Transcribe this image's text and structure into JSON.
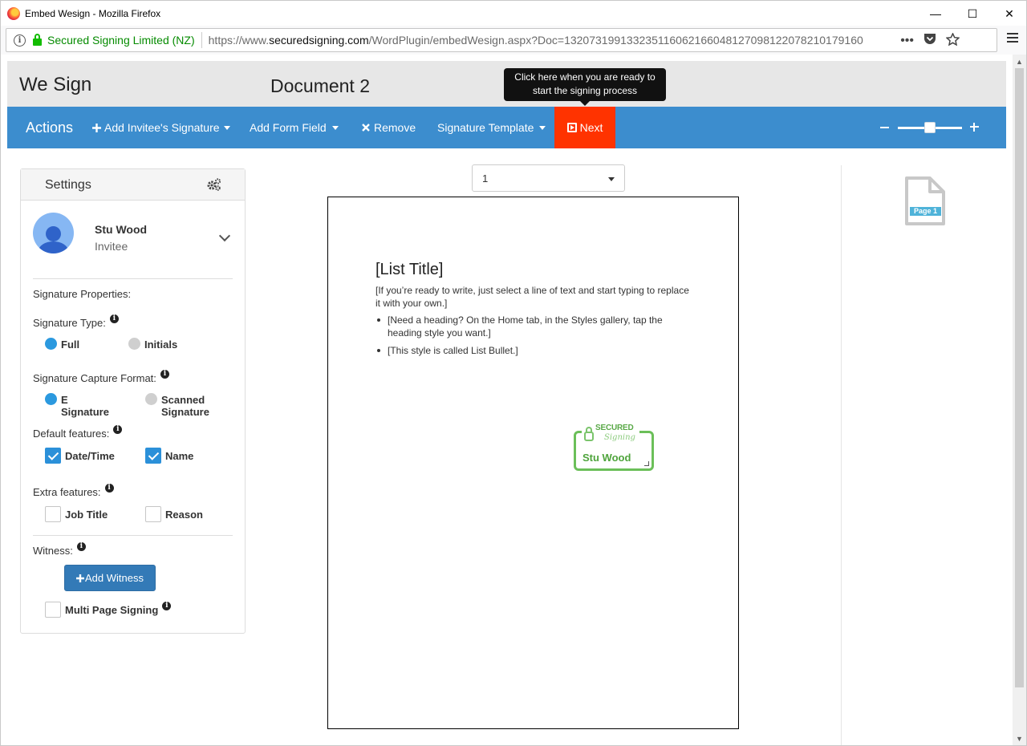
{
  "browser": {
    "window_title": "Embed Wesign - Mozilla Firefox",
    "identity_label": "Secured Signing Limited (NZ)",
    "url_prefix": "https://www.",
    "url_domain": "securedsigning.com",
    "url_path": "/WordPlugin/embedWesign.aspx?Doc=13207319913323511606216604812709812207821017916​0",
    "controls": {
      "minimize": "—",
      "maximize": "☐",
      "close": "✕"
    },
    "url_icons": [
      "more-icon",
      "pocket-icon",
      "bookmark-star-icon"
    ]
  },
  "app": {
    "brand": "We Sign",
    "document_title": "Document 2",
    "tooltip": "Click here when you are ready to start the signing process"
  },
  "toolbar": {
    "actions": "Actions",
    "add_invitee": "Add Invitee's Signature",
    "add_form_field": "Add Form Field",
    "remove": "Remove",
    "signature_template": "Signature Template",
    "next": "Next",
    "zoom_level": 0.5
  },
  "settings": {
    "title": "Settings",
    "user_name": "Stu Wood",
    "user_role": "Invitee",
    "signature_properties": "Signature Properties:",
    "signature_type_label": "Signature Type:",
    "signature_type_options": [
      {
        "label": "Full",
        "selected": true
      },
      {
        "label": "Initials",
        "selected": false
      }
    ],
    "capture_format_label": "Signature Capture Format:",
    "capture_format_options": [
      {
        "line1": "E",
        "line2": "Signature",
        "selected": true
      },
      {
        "line1": "Scanned",
        "line2": "Signature",
        "selected": false
      }
    ],
    "default_features_label": "Default features:",
    "default_features": [
      {
        "label": "Date/Time",
        "checked": true
      },
      {
        "label": "Name",
        "checked": true
      }
    ],
    "extra_features_label": "Extra features:",
    "extra_features": [
      {
        "label": "Job Title",
        "checked": false
      },
      {
        "label": "Reason",
        "checked": false
      }
    ],
    "witness_label": "Witness:",
    "add_witness": "Add Witness",
    "multi_page_signing": "Multi Page Signing",
    "multi_page_checked": false
  },
  "viewer": {
    "page_select_value": "1",
    "doc_list_title": "[List Title]",
    "doc_paragraph": "[If you’re ready to write, just select a line of text and start typing to replace it with your own.]",
    "doc_bullets": [
      "[Need a heading? On the Home tab, in the Styles gallery, tap the heading style you want.]",
      "[This style is called List Bullet.]"
    ],
    "sig_watermark_top": "SECURED",
    "sig_watermark_bottom": "Signing",
    "sig_name": "Stu Wood"
  },
  "thumbnails": [
    {
      "label": "Page 1"
    }
  ]
}
